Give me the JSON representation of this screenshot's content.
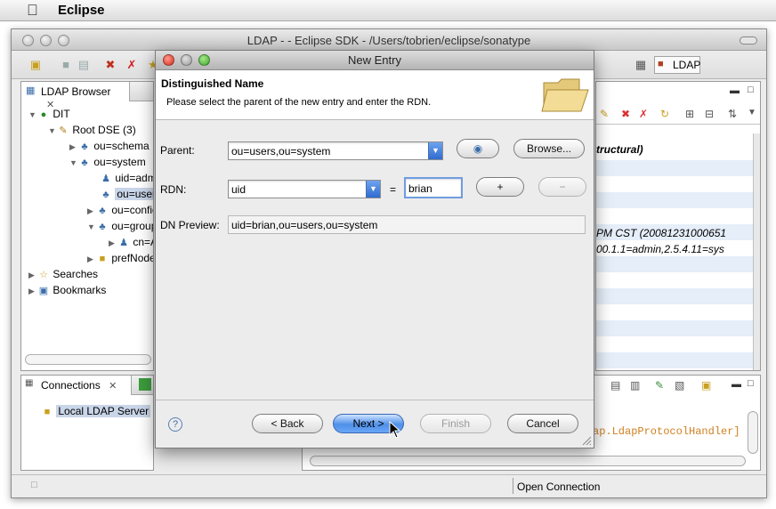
{
  "menubar": {
    "app_name": "Eclipse"
  },
  "window": {
    "title": "LDAP - - Eclipse SDK - /Users/tobrien/eclipse/sonatype"
  },
  "toolbar": {
    "perspective_label": "LDAP"
  },
  "ldap_browser": {
    "tab_label": "LDAP Browser",
    "tree": [
      {
        "label": "DIT"
      },
      {
        "label": "Root DSE (3)"
      },
      {
        "label": "ou=schema"
      },
      {
        "label": "ou=system"
      },
      {
        "label": "uid=admin"
      },
      {
        "label": "ou=users"
      },
      {
        "label": "ou=configuration"
      },
      {
        "label": "ou=groups"
      },
      {
        "label": "cn=Administrators"
      },
      {
        "label": "prefNodeName=sysPrefRoot"
      },
      {
        "label": "Searches"
      },
      {
        "label": "Bookmarks"
      }
    ]
  },
  "connections": {
    "tab_label": "Connections",
    "items": [
      {
        "label": "Local LDAP Server"
      }
    ]
  },
  "editor": {
    "text_structural": "tructural)",
    "text_time": "PM CST (20081231000651",
    "text_oid": "00.1.1=admin,2.5.4.11=sys",
    "console_text": "ap.LdapProtocolHandler]"
  },
  "status": {
    "text": "Open Connection"
  },
  "dialog": {
    "title": "New Entry",
    "heading": "Distinguished Name",
    "description": "Please select the parent of the new entry and enter the RDN.",
    "parent_label": "Parent:",
    "parent_value": "ou=users,ou=system",
    "browse_label": "Browse...",
    "rdn_label": "RDN:",
    "rdn_attr": "uid",
    "equals": "=",
    "rdn_value": "brian",
    "add_label": "+",
    "remove_label": "−",
    "preview_label": "DN Preview:",
    "preview_value": "uid=brian,ou=users,ou=system",
    "help_label": "?",
    "back_label": "< Back",
    "next_label": "Next >",
    "finish_label": "Finish",
    "cancel_label": "Cancel"
  }
}
